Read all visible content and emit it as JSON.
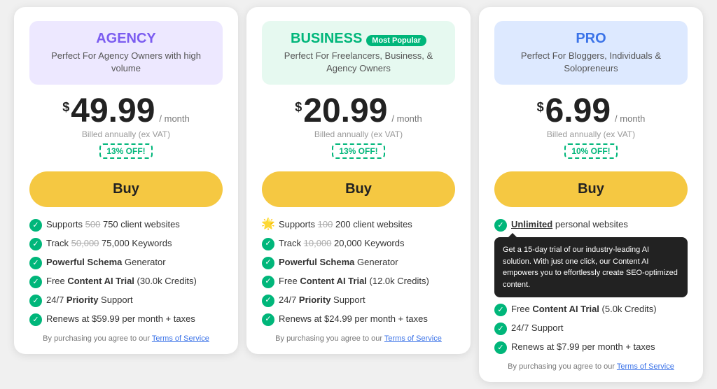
{
  "cards": [
    {
      "id": "agency",
      "header_class": "agency",
      "name_class": "agency",
      "plan_name": "AGENCY",
      "most_popular": false,
      "plan_desc": "Perfect For Agency Owners with high volume",
      "price_dollar": "$",
      "price_amount": "49.99",
      "price_period": "/ month",
      "billed_text": "Billed annually (ex VAT)",
      "discount": "13% OFF!",
      "buy_label": "Buy",
      "features": [
        {
          "type": "check",
          "text_parts": [
            {
              "t": "Supports "
            },
            {
              "t": "500",
              "s": true
            },
            {
              "t": " 750 client websites"
            }
          ]
        },
        {
          "type": "check",
          "text_parts": [
            {
              "t": "Track "
            },
            {
              "t": "50,000",
              "s": true
            },
            {
              "t": " 75,000 Keywords"
            }
          ]
        },
        {
          "type": "check",
          "text_parts": [
            {
              "t": "Powerful ",
              "b": true
            },
            {
              "t": "Schema",
              "b": true
            },
            {
              "t": " Generator"
            }
          ]
        },
        {
          "type": "check",
          "text_parts": [
            {
              "t": "Free "
            },
            {
              "t": "Content AI Trial",
              "b": true
            },
            {
              "t": " (30.0k Credits)"
            }
          ]
        },
        {
          "type": "check",
          "text_parts": [
            {
              "t": "24/7 "
            },
            {
              "t": "Priority",
              "b": true
            },
            {
              "t": " Support"
            }
          ]
        },
        {
          "type": "check",
          "text_parts": [
            {
              "t": "Renews at $59.99 per month + taxes"
            }
          ]
        }
      ],
      "tos_text": "By purchasing you agree to our ",
      "tos_link": "Terms of Service"
    },
    {
      "id": "business",
      "header_class": "business",
      "name_class": "business",
      "plan_name": "BUSINESS",
      "most_popular": true,
      "most_popular_label": "Most Popular",
      "plan_desc": "Perfect For Freelancers, Business, & Agency Owners",
      "price_dollar": "$",
      "price_amount": "20.99",
      "price_period": "/ month",
      "billed_text": "Billed annually (ex VAT)",
      "discount": "13% OFF!",
      "buy_label": "Buy",
      "features": [
        {
          "type": "sun",
          "text_parts": [
            {
              "t": "Supports "
            },
            {
              "t": "100",
              "s": true
            },
            {
              "t": " 200 client websites"
            }
          ]
        },
        {
          "type": "check",
          "text_parts": [
            {
              "t": "Track "
            },
            {
              "t": "10,000",
              "s": true
            },
            {
              "t": " 20,000 Keywords"
            }
          ]
        },
        {
          "type": "check",
          "text_parts": [
            {
              "t": "Powerful ",
              "b": true
            },
            {
              "t": "Schema",
              "b": true
            },
            {
              "t": " Generator"
            }
          ]
        },
        {
          "type": "check",
          "text_parts": [
            {
              "t": "Free "
            },
            {
              "t": "Content AI Trial",
              "b": true
            },
            {
              "t": " (12.0k Credits)"
            }
          ]
        },
        {
          "type": "check",
          "text_parts": [
            {
              "t": "24/7 "
            },
            {
              "t": "Priority",
              "b": true
            },
            {
              "t": " Support"
            }
          ]
        },
        {
          "type": "check",
          "text_parts": [
            {
              "t": "Renews at $24.99 per month + taxes"
            }
          ]
        }
      ],
      "tos_text": "By purchasing you agree to our ",
      "tos_link": "Terms of Service"
    },
    {
      "id": "pro",
      "header_class": "pro",
      "name_class": "pro",
      "plan_name": "PRO",
      "most_popular": false,
      "plan_desc": "Perfect For Bloggers, Individuals & Solopreneurs",
      "price_dollar": "$",
      "price_amount": "6.99",
      "price_period": "/ month",
      "billed_text": "Billed annually (ex VAT)",
      "discount": "10% OFF!",
      "buy_label": "Buy",
      "tooltip": "Get a 15-day trial of our industry-leading AI solution. With just one click, our Content AI empowers you to effortlessly create SEO-optimized content.",
      "features": [
        {
          "type": "check",
          "text_parts": [
            {
              "t": "Unlimited",
              "u": true,
              "b": true
            },
            {
              "t": " personal websites"
            }
          ]
        },
        {
          "type": "check",
          "text_parts": [
            {
              "t": "Free "
            },
            {
              "t": "Content AI Trial",
              "b": true
            },
            {
              "t": " (5.0k Credits)"
            }
          ],
          "has_tooltip": true
        },
        {
          "type": "check",
          "text_parts": [
            {
              "t": "24/7 Support"
            }
          ]
        },
        {
          "type": "check",
          "text_parts": [
            {
              "t": "Renews at $7.99 per month + taxes"
            }
          ]
        }
      ],
      "tos_text": "By purchasing you agree to our ",
      "tos_link": "Terms of Service"
    }
  ]
}
